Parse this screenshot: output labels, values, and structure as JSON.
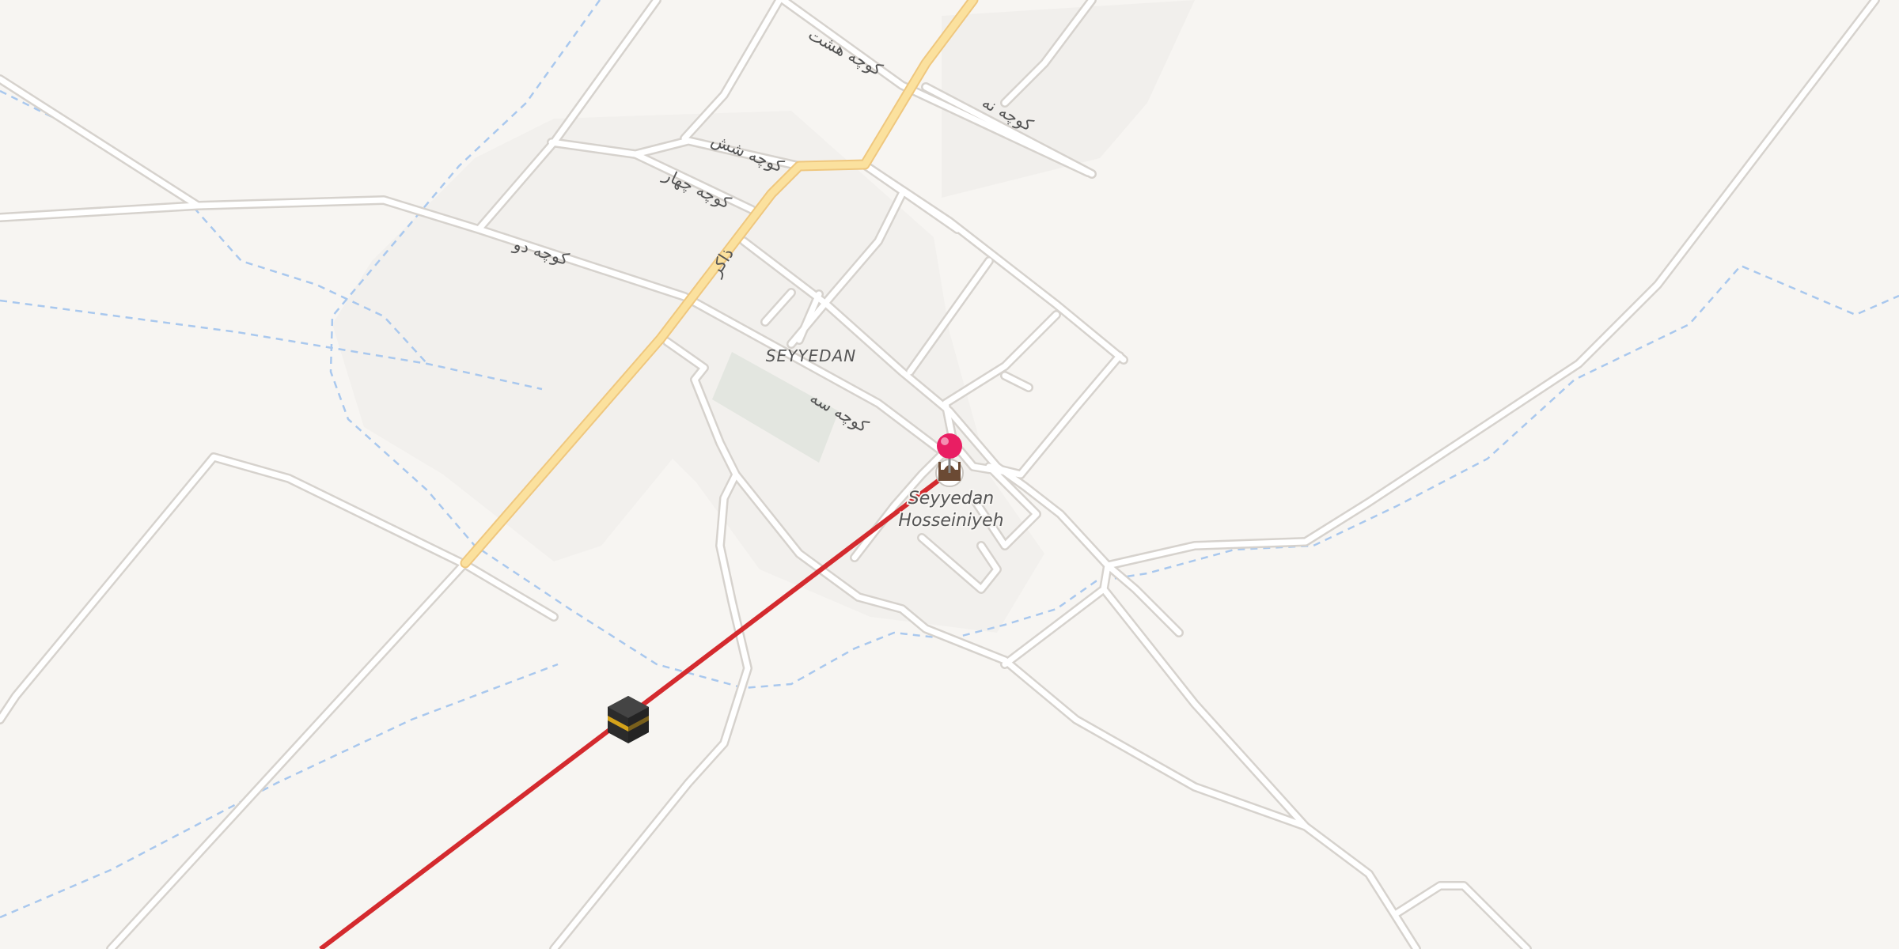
{
  "map": {
    "place_label": "SEYYEDAN",
    "poi": {
      "name_line1": "Seyyedan",
      "name_line2": "Hosseiniyeh",
      "icon": "mosque-icon"
    },
    "markers": {
      "pin": "location-pin-icon",
      "qibla": "kaaba-icon"
    },
    "street_labels": {
      "s1": "کوچه هشت",
      "s2": "کوچه نه",
      "s3": "کوچه شش",
      "s4": "کوچه چهار",
      "s5": "کوچه دو",
      "s6": "کوچه سه",
      "main_road": "ذاکر"
    },
    "colors": {
      "background": "#f7f5f2",
      "residential": "#f1efec",
      "park": "#e3e6e0",
      "road_outline": "#d6d2cd",
      "road_fill": "#ffffff",
      "primary_road": "#fbe19e",
      "primary_road_outline": "#efc77e",
      "waterway": "#a9c8ee",
      "qibla_line": "#d42a2e",
      "pin": "#e91e63"
    }
  }
}
